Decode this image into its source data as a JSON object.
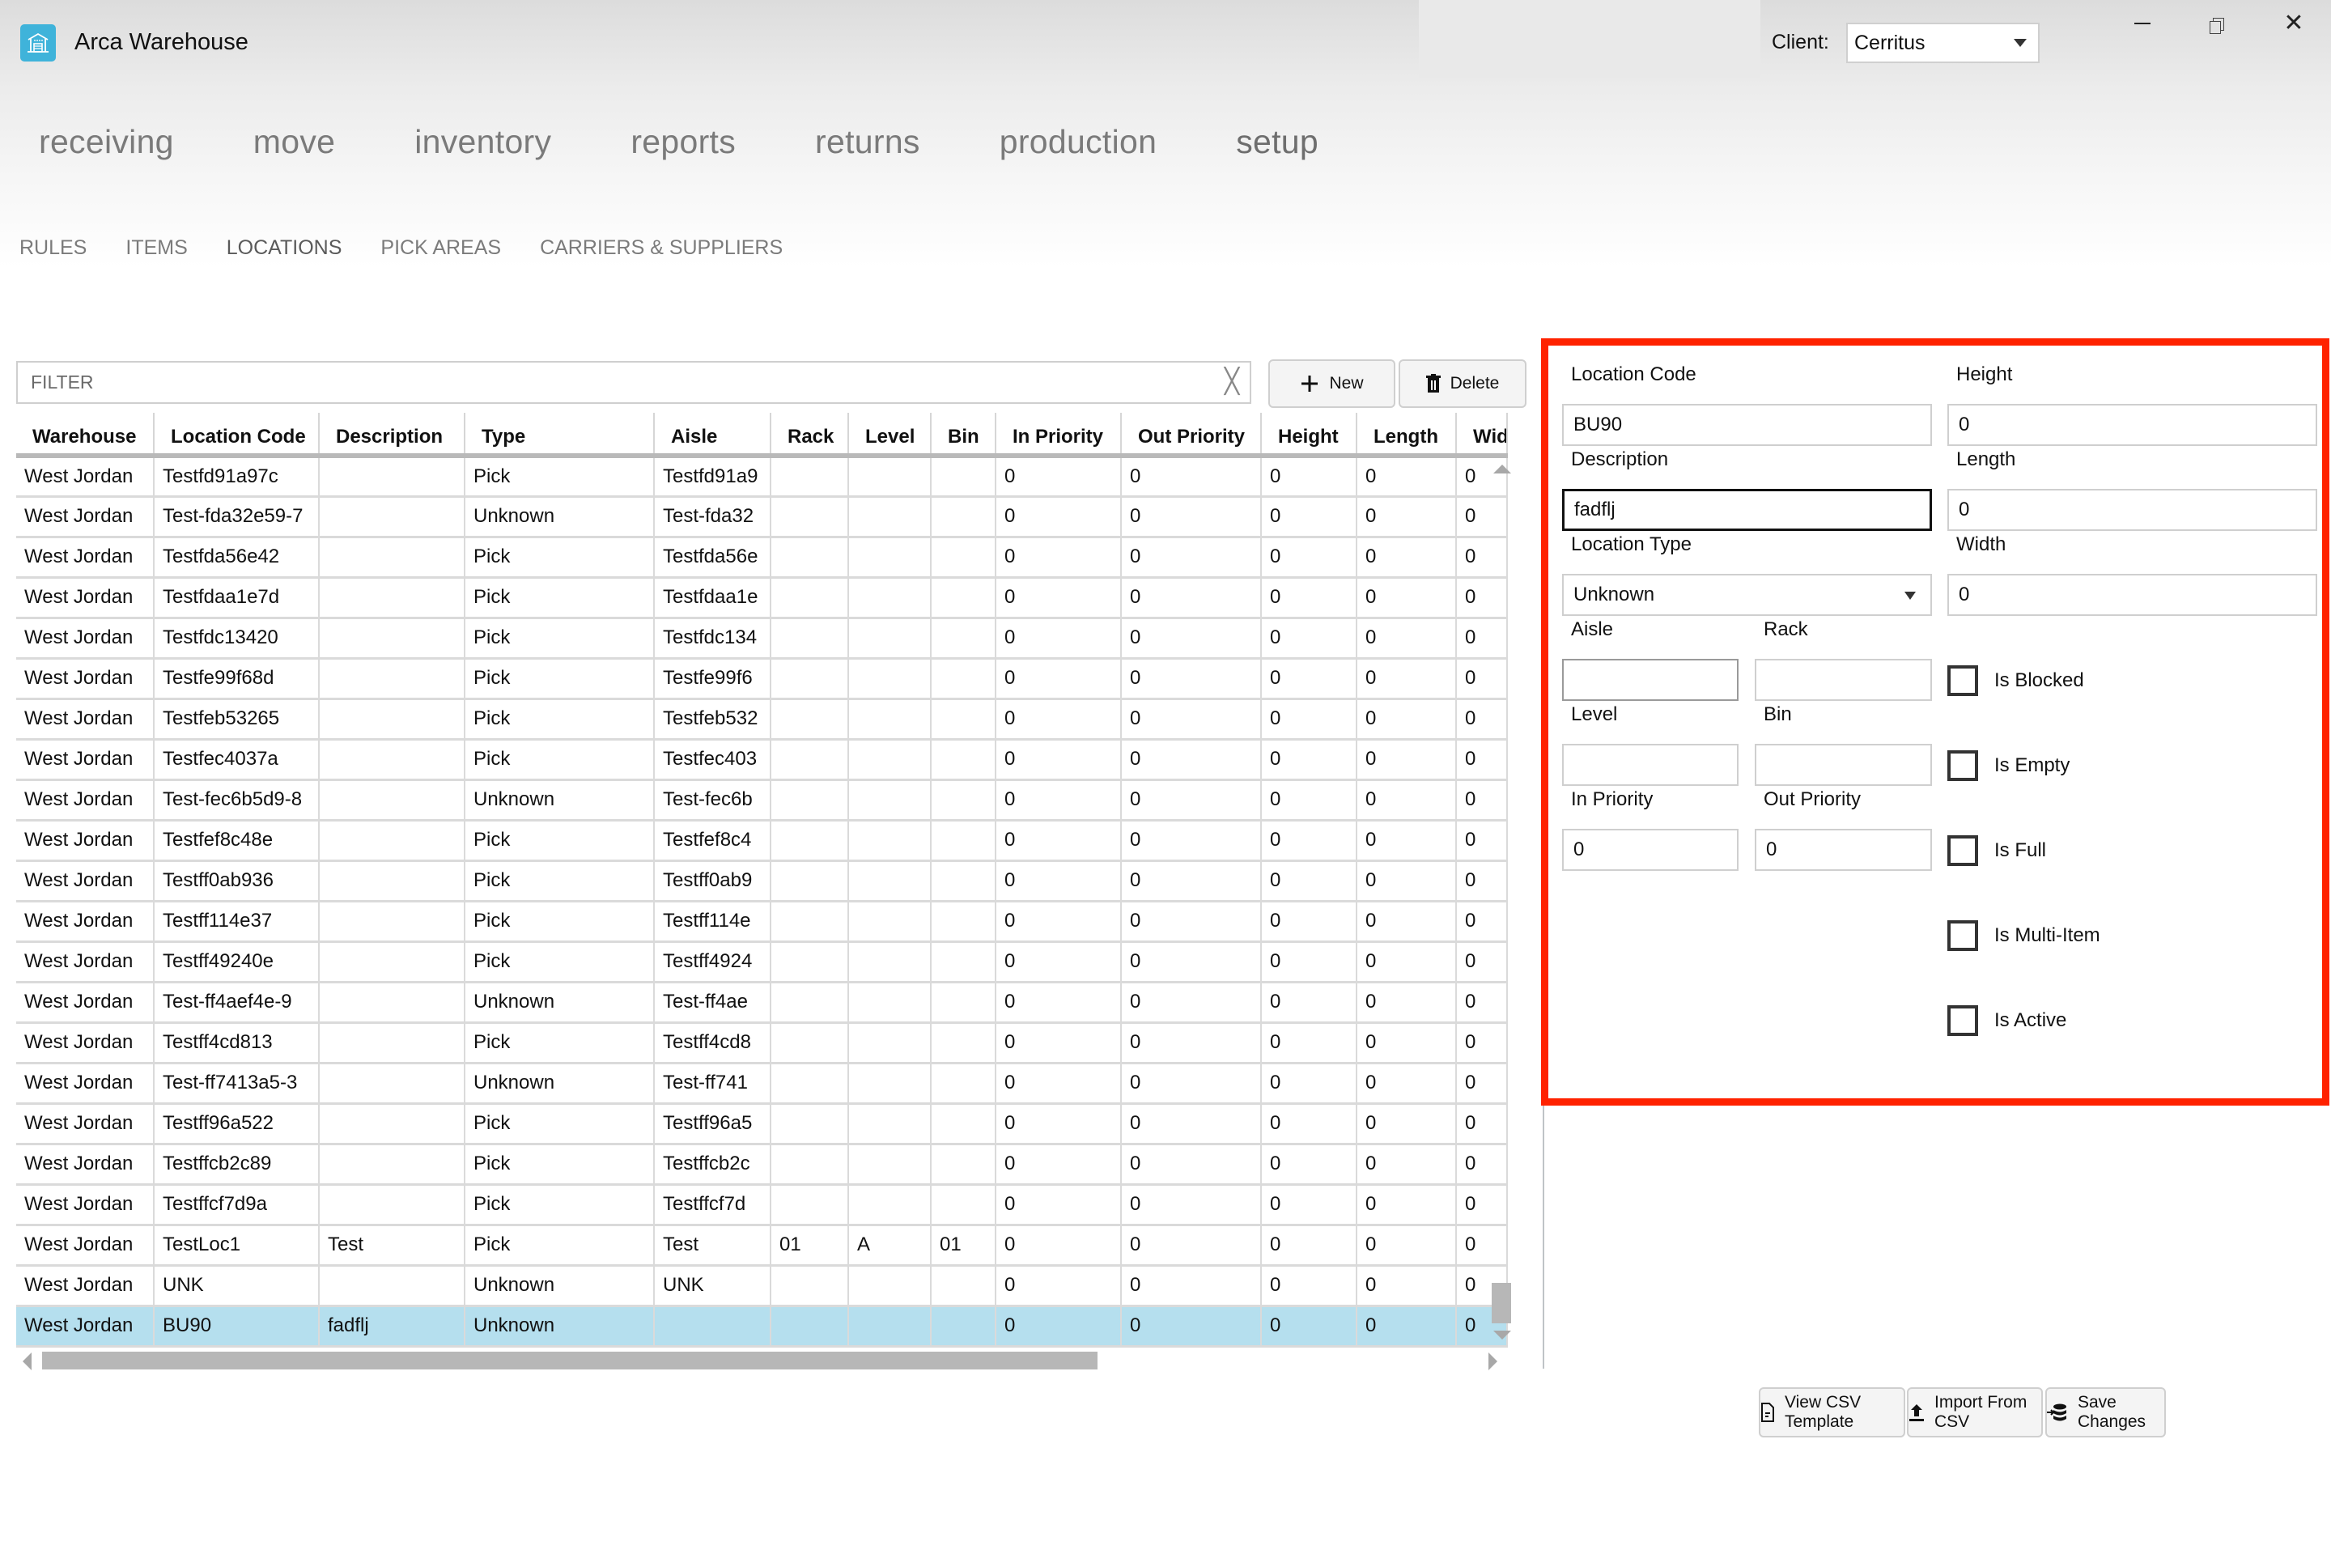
{
  "app": {
    "title": "Arca Warehouse",
    "logo_icon": "warehouse-icon",
    "client_label": "Client:",
    "client_value": "Cerritus",
    "window_controls": [
      "minimize-icon",
      "restore-icon",
      "close-icon"
    ],
    "close_glyph": "✕"
  },
  "nav": {
    "main_tabs": [
      {
        "label": "receiving",
        "active": false
      },
      {
        "label": "move",
        "active": false
      },
      {
        "label": "inventory",
        "active": false
      },
      {
        "label": "reports",
        "active": false
      },
      {
        "label": "returns",
        "active": false
      },
      {
        "label": "production",
        "active": false
      },
      {
        "label": "setup",
        "active": true
      }
    ],
    "sub_tabs": [
      {
        "label": "RULES",
        "active": false
      },
      {
        "label": "ITEMS",
        "active": false
      },
      {
        "label": "LOCATIONS",
        "active": true
      },
      {
        "label": "PICK AREAS",
        "active": false
      },
      {
        "label": "CARRIERS & SUPPLIERS",
        "active": false
      }
    ]
  },
  "toolbar": {
    "filter_placeholder": "FILTER",
    "filter_value": "",
    "clear_glyph": "╳",
    "new_label": "New",
    "delete_label": "Delete"
  },
  "grid": {
    "columns": [
      "Warehouse",
      "Location Code",
      "Description",
      "Type",
      "Aisle",
      "Rack",
      "Level",
      "Bin",
      "In Priority",
      "Out Priority",
      "Height",
      "Length",
      "Wid"
    ],
    "rows": [
      [
        "West Jordan",
        "Testfd91a97c",
        "",
        "Pick",
        "Testfd91a9",
        "",
        "",
        "",
        "0",
        "0",
        "0",
        "0",
        "0"
      ],
      [
        "West Jordan",
        "Test-fda32e59-7",
        "",
        "Unknown",
        "Test-fda32",
        "",
        "",
        "",
        "0",
        "0",
        "0",
        "0",
        "0"
      ],
      [
        "West Jordan",
        "Testfda56e42",
        "",
        "Pick",
        "Testfda56e",
        "",
        "",
        "",
        "0",
        "0",
        "0",
        "0",
        "0"
      ],
      [
        "West Jordan",
        "Testfdaa1e7d",
        "",
        "Pick",
        "Testfdaa1e",
        "",
        "",
        "",
        "0",
        "0",
        "0",
        "0",
        "0"
      ],
      [
        "West Jordan",
        "Testfdc13420",
        "",
        "Pick",
        "Testfdc134",
        "",
        "",
        "",
        "0",
        "0",
        "0",
        "0",
        "0"
      ],
      [
        "West Jordan",
        "Testfe99f68d",
        "",
        "Pick",
        "Testfe99f6",
        "",
        "",
        "",
        "0",
        "0",
        "0",
        "0",
        "0"
      ],
      [
        "West Jordan",
        "Testfeb53265",
        "",
        "Pick",
        "Testfeb532",
        "",
        "",
        "",
        "0",
        "0",
        "0",
        "0",
        "0"
      ],
      [
        "West Jordan",
        "Testfec4037a",
        "",
        "Pick",
        "Testfec403",
        "",
        "",
        "",
        "0",
        "0",
        "0",
        "0",
        "0"
      ],
      [
        "West Jordan",
        "Test-fec6b5d9-8",
        "",
        "Unknown",
        "Test-fec6b",
        "",
        "",
        "",
        "0",
        "0",
        "0",
        "0",
        "0"
      ],
      [
        "West Jordan",
        "Testfef8c48e",
        "",
        "Pick",
        "Testfef8c4",
        "",
        "",
        "",
        "0",
        "0",
        "0",
        "0",
        "0"
      ],
      [
        "West Jordan",
        "Testff0ab936",
        "",
        "Pick",
        "Testff0ab9",
        "",
        "",
        "",
        "0",
        "0",
        "0",
        "0",
        "0"
      ],
      [
        "West Jordan",
        "Testff114e37",
        "",
        "Pick",
        "Testff114e",
        "",
        "",
        "",
        "0",
        "0",
        "0",
        "0",
        "0"
      ],
      [
        "West Jordan",
        "Testff49240e",
        "",
        "Pick",
        "Testff4924",
        "",
        "",
        "",
        "0",
        "0",
        "0",
        "0",
        "0"
      ],
      [
        "West Jordan",
        "Test-ff4aef4e-9",
        "",
        "Unknown",
        "Test-ff4ae",
        "",
        "",
        "",
        "0",
        "0",
        "0",
        "0",
        "0"
      ],
      [
        "West Jordan",
        "Testff4cd813",
        "",
        "Pick",
        "Testff4cd8",
        "",
        "",
        "",
        "0",
        "0",
        "0",
        "0",
        "0"
      ],
      [
        "West Jordan",
        "Test-ff7413a5-3",
        "",
        "Unknown",
        "Test-ff741",
        "",
        "",
        "",
        "0",
        "0",
        "0",
        "0",
        "0"
      ],
      [
        "West Jordan",
        "Testff96a522",
        "",
        "Pick",
        "Testff96a5",
        "",
        "",
        "",
        "0",
        "0",
        "0",
        "0",
        "0"
      ],
      [
        "West Jordan",
        "Testffcb2c89",
        "",
        "Pick",
        "Testffcb2c",
        "",
        "",
        "",
        "0",
        "0",
        "0",
        "0",
        "0"
      ],
      [
        "West Jordan",
        "Testffcf7d9a",
        "",
        "Pick",
        "Testffcf7d",
        "",
        "",
        "",
        "0",
        "0",
        "0",
        "0",
        "0"
      ],
      [
        "West Jordan",
        "TestLoc1",
        "Test",
        "Pick",
        "Test",
        "01",
        "A",
        "01",
        "0",
        "0",
        "0",
        "0",
        "0"
      ],
      [
        "West Jordan",
        "UNK",
        "",
        "Unknown",
        "UNK",
        "",
        "",
        "",
        "0",
        "0",
        "0",
        "0",
        "0"
      ],
      [
        "West Jordan",
        "BU90",
        "fadflj",
        "Unknown",
        "",
        "",
        "",
        "",
        "0",
        "0",
        "0",
        "0",
        "0"
      ]
    ],
    "selected_row_index": 21,
    "vertical_scroll_position": 0.95,
    "horizontal_scroll_fraction_visible": 0.72,
    "selected_row_color": "#b5dfee"
  },
  "detail": {
    "border_color": "#ff2200",
    "location_code": {
      "label": "Location Code",
      "value": "BU90"
    },
    "description": {
      "label": "Description",
      "value": "fadflj"
    },
    "location_type": {
      "label": "Location Type",
      "value": "Unknown"
    },
    "aisle": {
      "label": "Aisle",
      "value": ""
    },
    "rack": {
      "label": "Rack",
      "value": ""
    },
    "level": {
      "label": "Level",
      "value": ""
    },
    "bin": {
      "label": "Bin",
      "value": ""
    },
    "in_priority": {
      "label": "In Priority",
      "value": "0"
    },
    "out_priority": {
      "label": "Out Priority",
      "value": "0"
    },
    "height": {
      "label": "Height",
      "value": "0"
    },
    "length": {
      "label": "Length",
      "value": "0"
    },
    "width": {
      "label": "Width",
      "value": "0"
    },
    "checkboxes": [
      {
        "label": "Is Blocked",
        "checked": false
      },
      {
        "label": "Is Empty",
        "checked": false
      },
      {
        "label": "Is Full",
        "checked": false
      },
      {
        "label": "Is Multi-Item",
        "checked": false
      },
      {
        "label": "Is Active",
        "checked": false
      }
    ]
  },
  "footer": {
    "view_csv_label": "View CSV Template",
    "import_csv_label": "Import From CSV",
    "save_label": "Save Changes"
  }
}
